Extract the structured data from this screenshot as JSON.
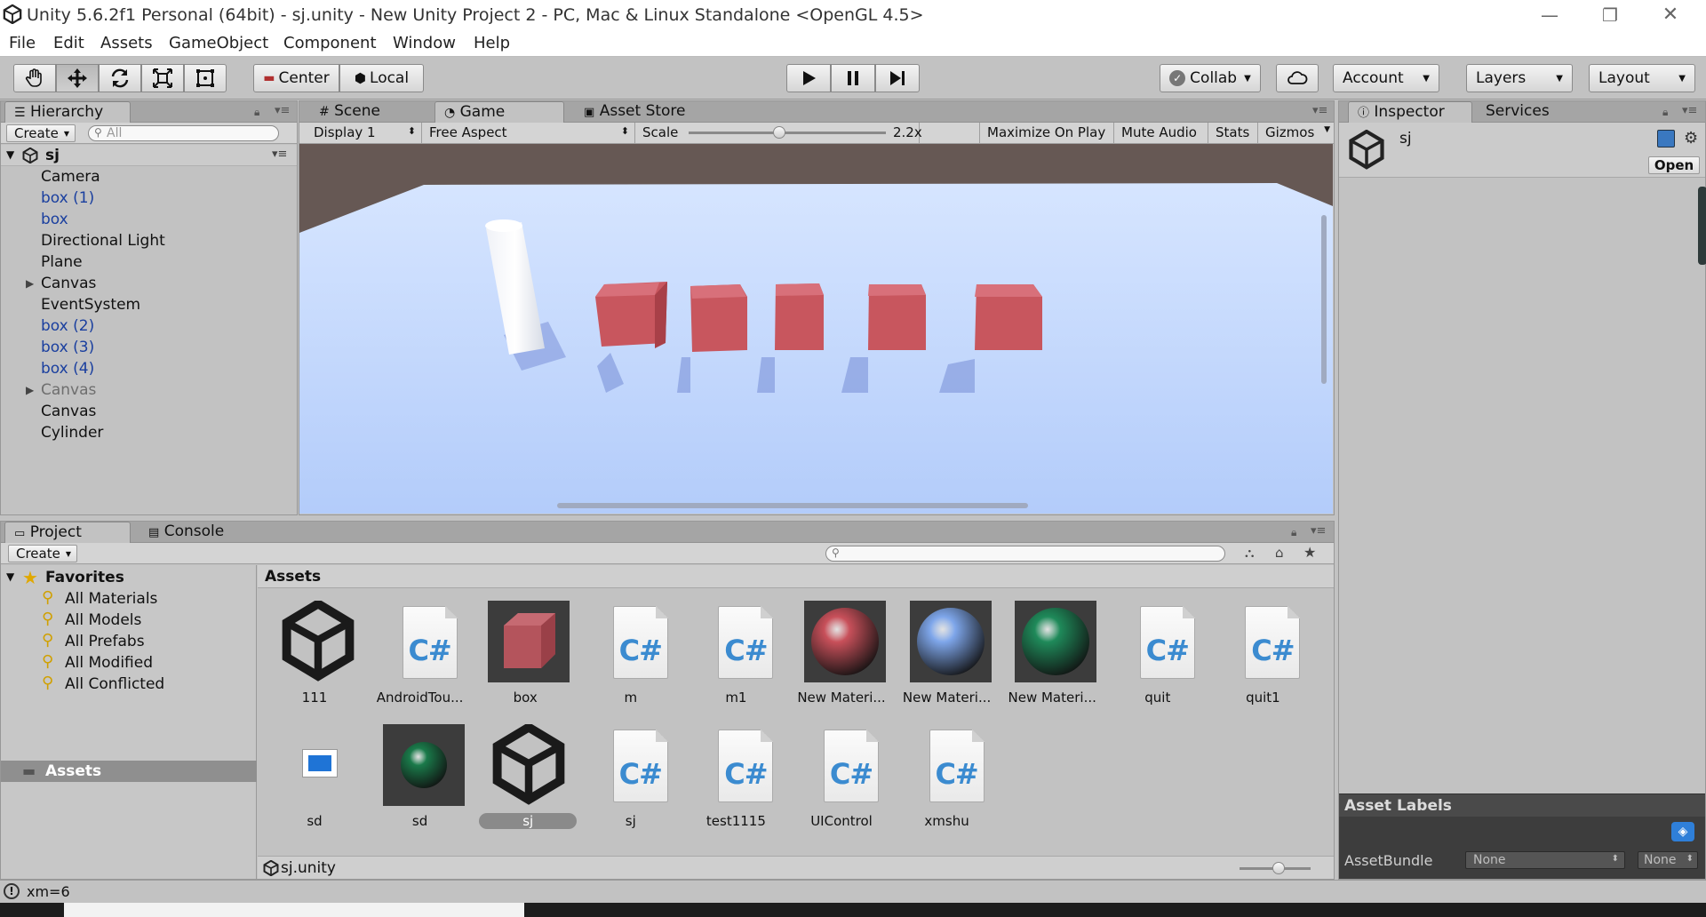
{
  "window": {
    "title": "Unity 5.6.2f1 Personal (64bit) - sj.unity - New Unity Project 2 - PC, Mac & Linux Standalone <OpenGL 4.5>",
    "minimize": "—",
    "maximize": "❐",
    "close": "✕"
  },
  "menu": [
    "File",
    "Edit",
    "Assets",
    "GameObject",
    "Component",
    "Window",
    "Help"
  ],
  "toolbar": {
    "pivot_center": "Center",
    "pivot_local": "Local",
    "collab": "Collab",
    "account": "Account",
    "layers": "Layers",
    "layout": "Layout"
  },
  "hierarchy": {
    "tab": "Hierarchy",
    "create": "Create",
    "search_placeholder": "All",
    "scene": "sj",
    "items": [
      {
        "label": "Camera",
        "style": "normal"
      },
      {
        "label": "box (1)",
        "style": "prefab"
      },
      {
        "label": "box",
        "style": "prefab"
      },
      {
        "label": "Directional Light",
        "style": "normal"
      },
      {
        "label": "Plane",
        "style": "normal"
      },
      {
        "label": "Canvas",
        "style": "normal"
      },
      {
        "label": "EventSystem",
        "style": "normal"
      },
      {
        "label": "box (2)",
        "style": "prefab"
      },
      {
        "label": "box (3)",
        "style": "prefab"
      },
      {
        "label": "box (4)",
        "style": "prefab"
      },
      {
        "label": "Canvas",
        "style": "dim"
      },
      {
        "label": "Canvas",
        "style": "normal"
      },
      {
        "label": "Cylinder",
        "style": "normal"
      }
    ]
  },
  "center_tabs": {
    "scene": "Scene",
    "game": "Game",
    "asset_store": "Asset Store"
  },
  "game_bar": {
    "display": "Display 1",
    "aspect": "Free Aspect",
    "scale_label": "Scale",
    "scale_value": "2.2x",
    "scale_fraction": 0.46,
    "maximize": "Maximize On Play",
    "mute": "Mute Audio",
    "stats": "Stats",
    "gizmos": "Gizmos"
  },
  "inspector": {
    "tab": "Inspector",
    "services_tab": "Services",
    "object_name": "sj",
    "open_button": "Open",
    "asset_labels": "Asset Labels",
    "asset_bundle": "AssetBundle",
    "bundle_name": "None",
    "bundle_variant": "None"
  },
  "project": {
    "tab": "Project",
    "console_tab": "Console",
    "create": "Create",
    "favorites_title": "Favorites",
    "favorites": [
      "All Materials",
      "All Models",
      "All Prefabs",
      "All Modified",
      "All Conflicted"
    ],
    "assets_folder": "Assets",
    "breadcrumb": "Assets",
    "footer_path": "sj.unity",
    "zoom_fraction": 0.55,
    "assets": [
      {
        "label": "111",
        "kind": "unity-scene"
      },
      {
        "label": "AndroidTou...",
        "kind": "cs-script"
      },
      {
        "label": "box",
        "kind": "prefab-box"
      },
      {
        "label": "m",
        "kind": "cs-script"
      },
      {
        "label": "m1",
        "kind": "cs-script"
      },
      {
        "label": "New Materi...",
        "kind": "material",
        "color": "#c8505a"
      },
      {
        "label": "New Materi...",
        "kind": "material",
        "color": "#7ea6ea"
      },
      {
        "label": "New Materi...",
        "kind": "material",
        "color": "#1f8a5a"
      },
      {
        "label": "quit",
        "kind": "cs-script"
      },
      {
        "label": "quit1",
        "kind": "cs-script"
      },
      {
        "label": "sd",
        "kind": "ui-image"
      },
      {
        "label": "sd",
        "kind": "material-dark",
        "color": "#1a7a4a"
      },
      {
        "label": "sj",
        "kind": "unity-scene-selected"
      },
      {
        "label": "sj",
        "kind": "cs-script"
      },
      {
        "label": "test1115",
        "kind": "cs-script"
      },
      {
        "label": "UIControl",
        "kind": "cs-script"
      },
      {
        "label": "xmshu",
        "kind": "cs-script"
      }
    ]
  },
  "status_bar": {
    "message": "xm=6"
  },
  "colors": {
    "editor_bg": "#c2c2c2",
    "game_sky": "#c9dcff",
    "game_ground_top": "#5f5450",
    "cube": "#c9585f",
    "prefab_text": "#1a3f9f"
  }
}
